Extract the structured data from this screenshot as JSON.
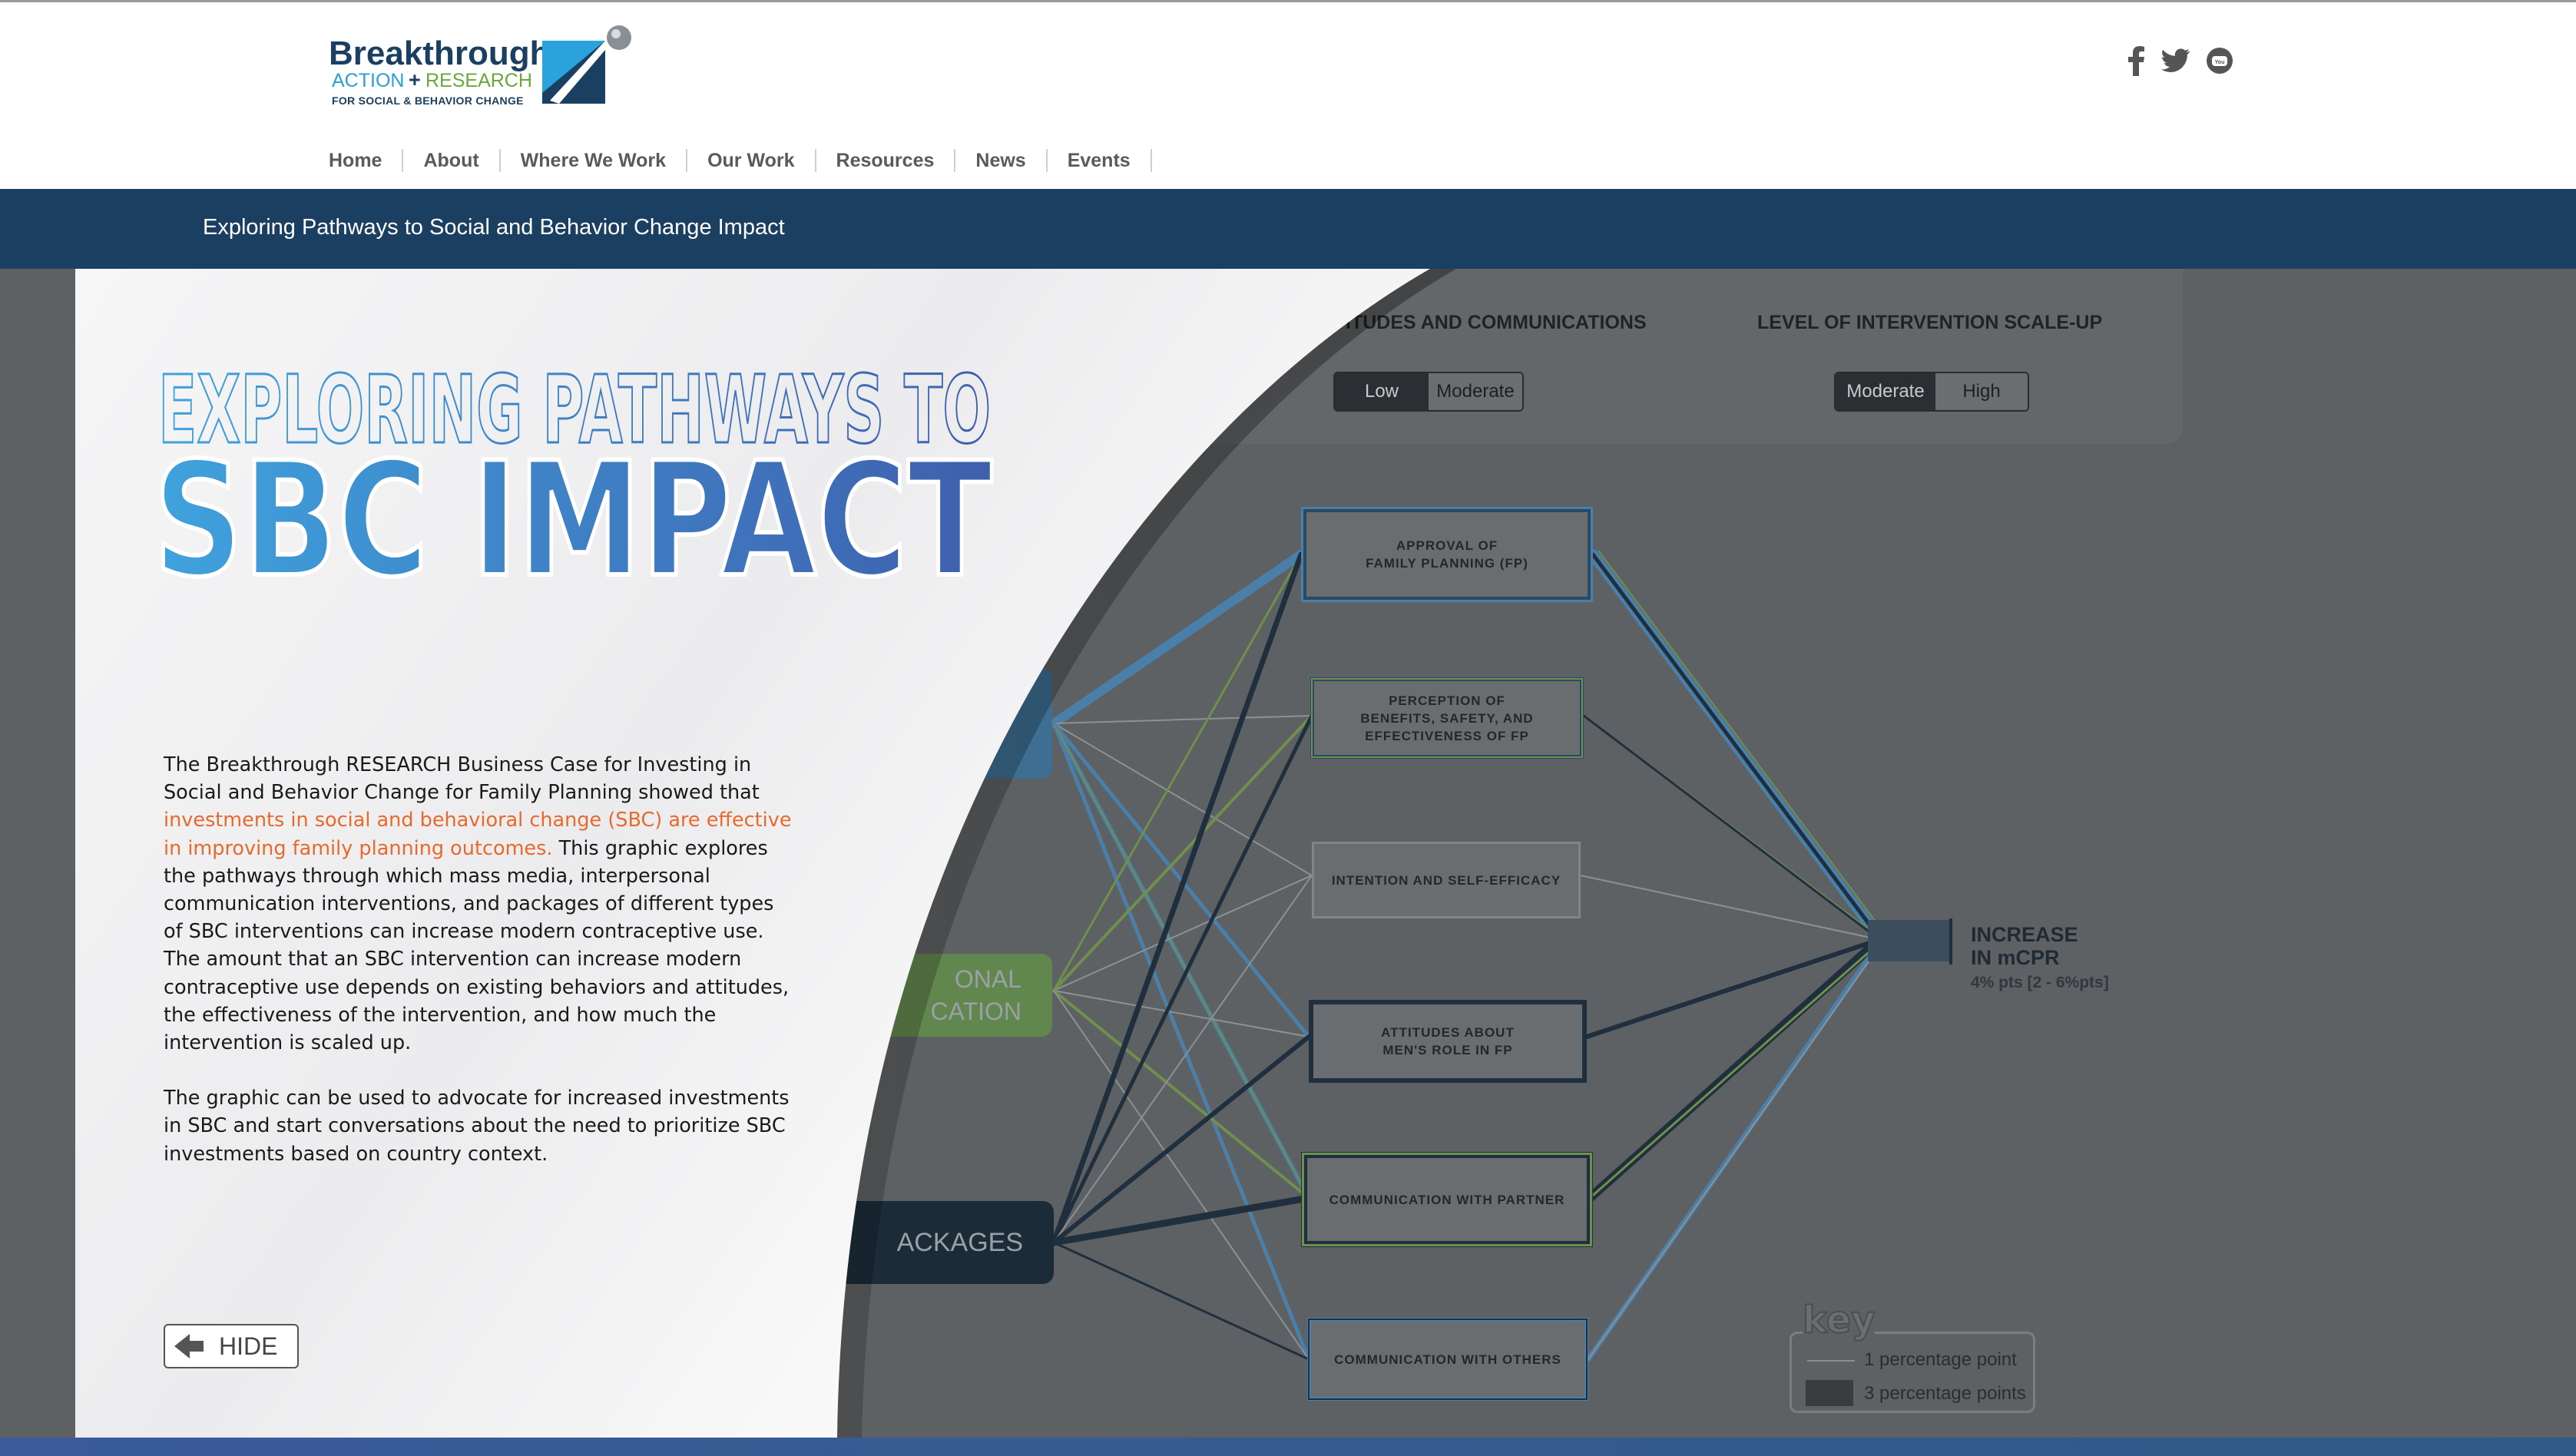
{
  "header": {
    "logo": {
      "line1": "Breakthrough",
      "line2_a": "ACTION",
      "line2_plus": "+",
      "line2_b": "RESEARCH",
      "line3": "FOR SOCIAL & BEHAVIOR CHANGE"
    },
    "nav": [
      "Home",
      "About",
      "Where We Work",
      "Our Work",
      "Resources",
      "News",
      "Events"
    ],
    "social": [
      "facebook-icon",
      "twitter-icon",
      "youtube-icon"
    ]
  },
  "banner": {
    "title": "Exploring Pathways to Social and Behavior Change Impact"
  },
  "controls": {
    "attitudes": {
      "title": "ITUDES AND COMMUNICATIONS",
      "options": [
        "Low",
        "Moderate"
      ],
      "selected": "Low"
    },
    "scaleup": {
      "title": "LEVEL OF INTERVENTION SCALE-UP",
      "options": [
        "Moderate",
        "High"
      ],
      "selected": "Moderate"
    }
  },
  "diagram": {
    "sources": [
      {
        "label": ""
      },
      {
        "label_line1": "ONAL",
        "label_line2": "CATION"
      },
      {
        "label": "ACKAGES"
      }
    ],
    "mediators": [
      {
        "line1": "APPROVAL OF",
        "line2": "FAMILY PLANNING (FP)"
      },
      {
        "line1": "PERCEPTION OF",
        "line2": "BENEFITS, SAFETY, AND",
        "line3": "EFFECTIVENESS OF FP"
      },
      {
        "line1": "INTENTION AND SELF-EFFICACY"
      },
      {
        "line1": "ATTITUDES ABOUT",
        "line2": "MEN'S ROLE IN FP"
      },
      {
        "line1": "COMMUNICATION WITH PARTNER"
      },
      {
        "line1": "COMMUNICATION WITH OTHERS"
      }
    ],
    "outcome": {
      "line1": "INCREASE",
      "line2": "IN mCPR",
      "detail": "4% pts [2 - 6%pts]"
    },
    "key": {
      "title": "key",
      "item1": "1 percentage point",
      "item2": "3 percentage points"
    }
  },
  "panel": {
    "title_line1": "EXPLORING PATHWAYS TO",
    "title_line2": "SBC IMPACT",
    "para1_a": "The Breakthrough RESEARCH Business Case for Investing in Social and Behavior Change for Family Planning showed that ",
    "para1_link": "investments in social and behavioral change (SBC) are effective in improving family planning outcomes.",
    "para1_b": " This graphic explores the pathways through which mass media, interpersonal communication interventions, and packages of different types of SBC interventions can increase modern contraceptive use. The amount that an SBC intervention can increase modern contraceptive use depends on existing behaviors and attitudes, the effectiveness of the intervention, and how much the intervention is scaled up.",
    "para2": "The graphic can be used to advocate for increased investments in SBC and start conversations about the need to prioritize SBC investments based on country context.",
    "hide_label": "HIDE"
  },
  "colors": {
    "brand_navy": "#1b3f60",
    "accent_orange": "#e8692c",
    "title_blue": "#3d7fc4"
  }
}
